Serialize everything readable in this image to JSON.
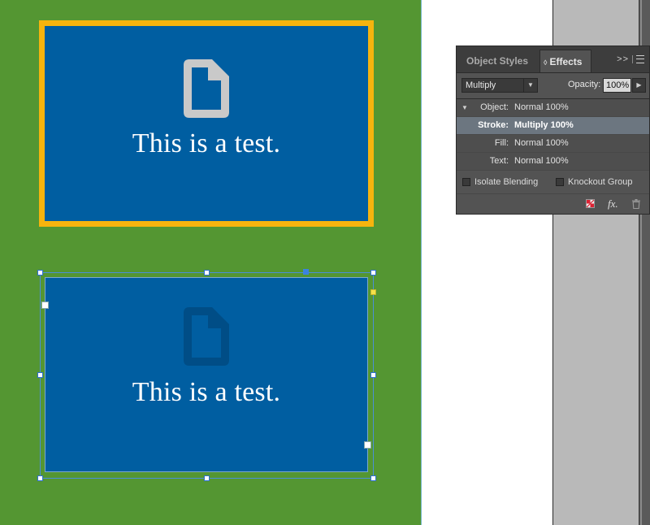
{
  "canvas": {
    "pasteboard_color": "#549632",
    "frame_fill": "#005ea1",
    "frame_stroke_color": "#f6b40e"
  },
  "frames": [
    {
      "text": "This is a test.",
      "icon": "document-icon",
      "icon_color": "#c9c9c9"
    },
    {
      "text": "This is a test.",
      "icon": "document-icon",
      "icon_color": "#004d86"
    }
  ],
  "effects_panel": {
    "tabs": {
      "object_styles": "Object Styles",
      "effects": "Effects"
    },
    "collapse_glyph": ">>",
    "blend_mode": "Multiply",
    "opacity_label": "Opacity:",
    "opacity_value": "100%",
    "rows": [
      {
        "label": "Object:",
        "value": "Normal 100%",
        "expanded": true
      },
      {
        "label": "Stroke:",
        "value": "Multiply 100%",
        "selected": true
      },
      {
        "label": "Fill:",
        "value": "Normal 100%"
      },
      {
        "label": "Text:",
        "value": "Normal 100%"
      }
    ],
    "isolate_blending_label": "Isolate Blending",
    "knockout_group_label": "Knockout Group",
    "footer": {
      "fx_label": "fx."
    }
  }
}
